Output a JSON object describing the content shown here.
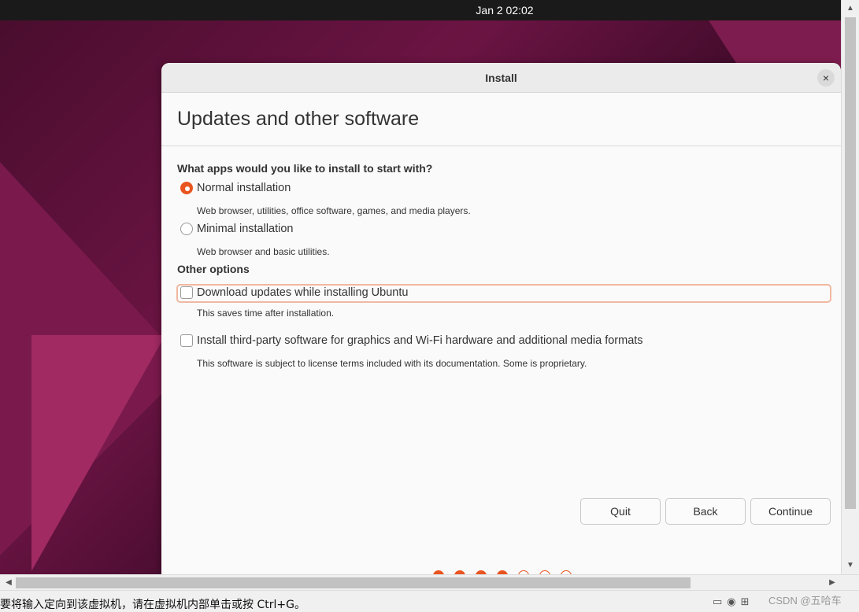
{
  "topbar": {
    "clock": "Jan 2  02:02"
  },
  "dialog": {
    "title": "Install",
    "close_icon": "×",
    "heading": "Updates and other software",
    "apps_question": "What apps would you like to install to start with?",
    "normal_label": "Normal installation",
    "normal_desc": "Web browser, utilities, office software, games, and media players.",
    "minimal_label": "Minimal installation",
    "minimal_desc": "Web browser and basic utilities.",
    "other_heading": "Other options",
    "updates_label": "Download updates while installing Ubuntu",
    "updates_desc": "This saves time after installation.",
    "thirdparty_label": "Install third-party software for graphics and Wi-Fi hardware and additional media formats",
    "thirdparty_desc": "This software is subject to license terms included with its documentation. Some is proprietary.",
    "selected_install": "normal",
    "download_updates_checked": false,
    "third_party_checked": false,
    "buttons": {
      "quit": "Quit",
      "back": "Back",
      "continue": "Continue"
    },
    "progress": {
      "steps_total": 7,
      "steps_done": 4
    }
  },
  "vm": {
    "status_text": "要将输入定向到该虚拟机，请在虚拟机内部单击或按 Ctrl+G。",
    "watermark": "CSDN @五哈车",
    "scroll_up": "▲",
    "scroll_down": "▼",
    "scroll_left": "◀",
    "scroll_right": "▶"
  },
  "colors": {
    "accent": "#e95420",
    "topbar": "#1a1a1a",
    "dialog_bg": "#fafafa"
  }
}
